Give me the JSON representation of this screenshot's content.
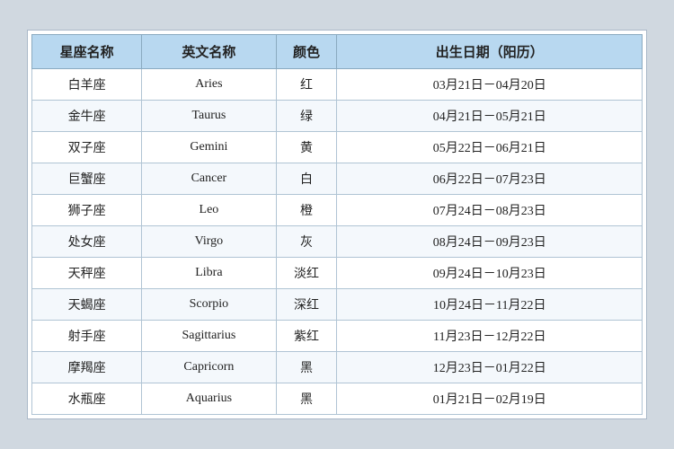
{
  "table": {
    "headers": [
      "星座名称",
      "英文名称",
      "颜色",
      "出生日期（阳历）"
    ],
    "rows": [
      {
        "zh": "白羊座",
        "en": "Aries",
        "color": "红",
        "date": "03月21日－04月20日"
      },
      {
        "zh": "金牛座",
        "en": "Taurus",
        "color": "绿",
        "date": "04月21日－05月21日"
      },
      {
        "zh": "双子座",
        "en": "Gemini",
        "color": "黄",
        "date": "05月22日－06月21日"
      },
      {
        "zh": "巨蟹座",
        "en": "Cancer",
        "color": "白",
        "date": "06月22日－07月23日"
      },
      {
        "zh": "狮子座",
        "en": "Leo",
        "color": "橙",
        "date": "07月24日－08月23日"
      },
      {
        "zh": "处女座",
        "en": "Virgo",
        "color": "灰",
        "date": "08月24日－09月23日"
      },
      {
        "zh": "天秤座",
        "en": "Libra",
        "color": "淡红",
        "date": "09月24日－10月23日"
      },
      {
        "zh": "天蝎座",
        "en": "Scorpio",
        "color": "深红",
        "date": "10月24日－11月22日"
      },
      {
        "zh": "射手座",
        "en": "Sagittarius",
        "color": "紫红",
        "date": "11月23日－12月22日"
      },
      {
        "zh": "摩羯座",
        "en": "Capricorn",
        "color": "黑",
        "date": "12月23日－01月22日"
      },
      {
        "zh": "水瓶座",
        "en": "Aquarius",
        "color": "黑",
        "date": "01月21日－02月19日"
      }
    ]
  }
}
